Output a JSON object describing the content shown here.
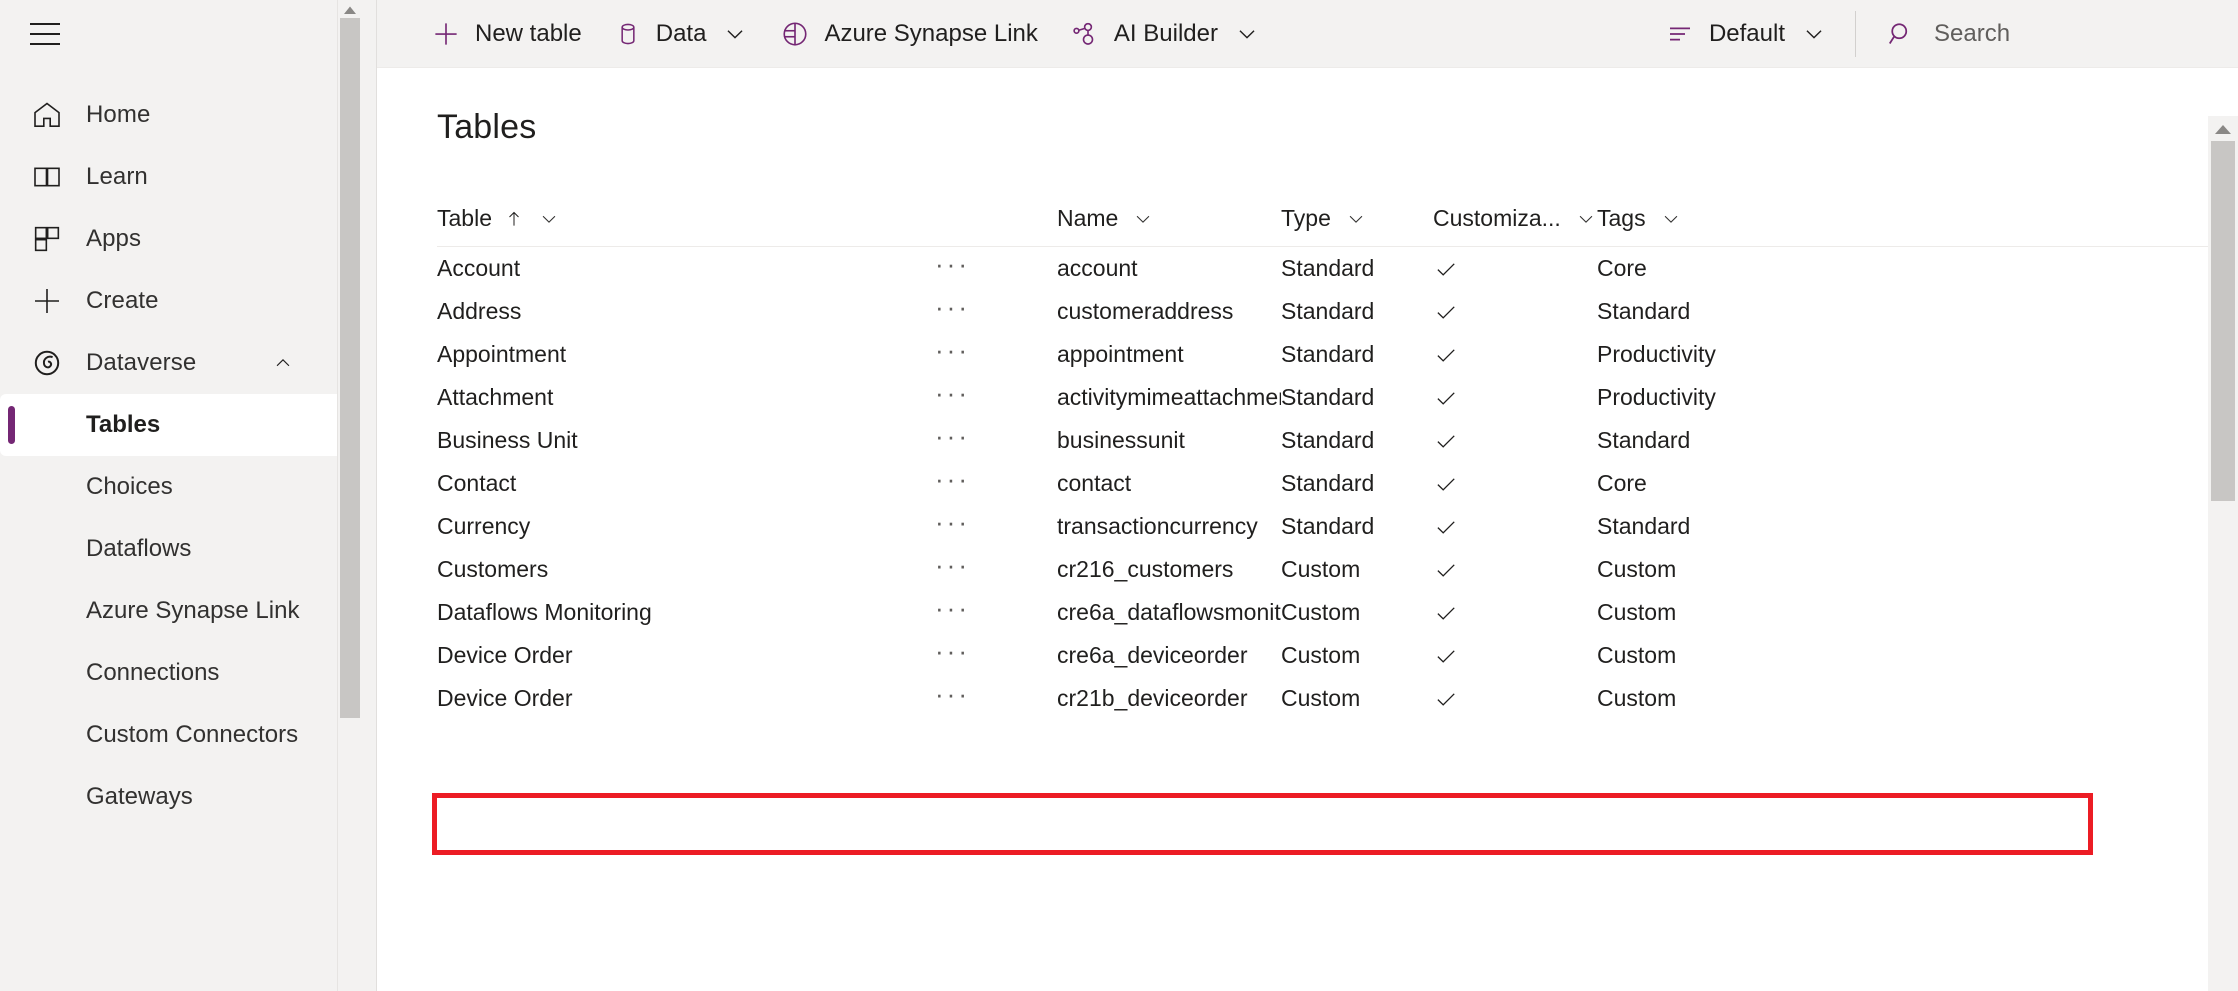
{
  "sidebar": {
    "menu_icon": "hamburger-icon",
    "items": [
      {
        "label": "Home",
        "icon": "home-icon"
      },
      {
        "label": "Learn",
        "icon": "book-icon"
      },
      {
        "label": "Apps",
        "icon": "apps-grid-icon"
      },
      {
        "label": "Create",
        "icon": "plus-icon"
      }
    ],
    "group": {
      "label": "Dataverse",
      "icon": "dataverse-icon",
      "expanded": true,
      "chevron": "chevron-up-icon",
      "sub_items": [
        {
          "label": "Tables",
          "selected": true
        },
        {
          "label": "Choices",
          "selected": false
        },
        {
          "label": "Dataflows",
          "selected": false
        },
        {
          "label": "Azure Synapse Link",
          "selected": false
        },
        {
          "label": "Connections",
          "selected": false
        },
        {
          "label": "Custom Connectors",
          "selected": false
        },
        {
          "label": "Gateways",
          "selected": false
        }
      ]
    }
  },
  "commandbar": {
    "items": [
      {
        "label": "New table",
        "icon": "plus-icon",
        "has_chevron": false
      },
      {
        "label": "Data",
        "icon": "database-icon",
        "has_chevron": true
      },
      {
        "label": "Azure Synapse Link",
        "icon": "synapse-pie-icon",
        "has_chevron": false
      },
      {
        "label": "AI Builder",
        "icon": "ai-builder-icon",
        "has_chevron": true
      }
    ],
    "view_selector": {
      "label": "Default",
      "icon": "view-list-icon",
      "chevron": "chevron-down-icon"
    },
    "search": {
      "placeholder": "Search",
      "icon": "search-icon",
      "value": ""
    }
  },
  "page": {
    "title": "Tables"
  },
  "grid": {
    "columns": [
      {
        "key": "table",
        "label": "Table",
        "sort": "asc",
        "sort_icon": "arrow-up-icon",
        "chevron": "chevron-down-icon"
      },
      {
        "key": "ellipsis",
        "label": "",
        "chevron": ""
      },
      {
        "key": "name",
        "label": "Name",
        "chevron": "chevron-down-icon"
      },
      {
        "key": "type",
        "label": "Type",
        "chevron": "chevron-down-icon"
      },
      {
        "key": "customizable",
        "label": "Customiza...",
        "chevron": "chevron-down-icon"
      },
      {
        "key": "tags",
        "label": "Tags",
        "chevron": "chevron-down-icon"
      }
    ],
    "row_menu_glyph": "···",
    "checkmark_glyph": "check-icon",
    "rows": [
      {
        "table": "Account",
        "name": "account",
        "type": "Standard",
        "customizable": true,
        "tags": "Core",
        "highlighted": false
      },
      {
        "table": "Address",
        "name": "customeraddress",
        "type": "Standard",
        "customizable": true,
        "tags": "Standard",
        "highlighted": false
      },
      {
        "table": "Appointment",
        "name": "appointment",
        "type": "Standard",
        "customizable": true,
        "tags": "Productivity",
        "highlighted": false
      },
      {
        "table": "Attachment",
        "name": "activitymimeattachment",
        "type": "Standard",
        "customizable": true,
        "tags": "Productivity",
        "highlighted": false
      },
      {
        "table": "Business Unit",
        "name": "businessunit",
        "type": "Standard",
        "customizable": true,
        "tags": "Standard",
        "highlighted": false
      },
      {
        "table": "Contact",
        "name": "contact",
        "type": "Standard",
        "customizable": true,
        "tags": "Core",
        "highlighted": false
      },
      {
        "table": "Currency",
        "name": "transactioncurrency",
        "type": "Standard",
        "customizable": true,
        "tags": "Standard",
        "highlighted": false
      },
      {
        "table": "Customers",
        "name": "cr216_customers",
        "type": "Custom",
        "customizable": true,
        "tags": "Custom",
        "highlighted": true
      },
      {
        "table": "Dataflows Monitoring",
        "name": "cre6a_dataflowsmonit...",
        "type": "Custom",
        "customizable": true,
        "tags": "Custom",
        "highlighted": false
      },
      {
        "table": "Device Order",
        "name": "cre6a_deviceorder",
        "type": "Custom",
        "customizable": true,
        "tags": "Custom",
        "highlighted": false
      },
      {
        "table": "Device Order",
        "name": "cr21b_deviceorder",
        "type": "Custom",
        "customizable": true,
        "tags": "Custom",
        "highlighted": false
      }
    ]
  },
  "annotation": {
    "highlight_color": "#ec1c24",
    "target_row": "Customers"
  },
  "colors": {
    "accent": "#742774",
    "nav_background": "#f3f2f1",
    "surface": "#ffffff",
    "text": "#201f1e",
    "muted_text": "#605e5c",
    "scrollbar_thumb": "#c8c6c4"
  }
}
